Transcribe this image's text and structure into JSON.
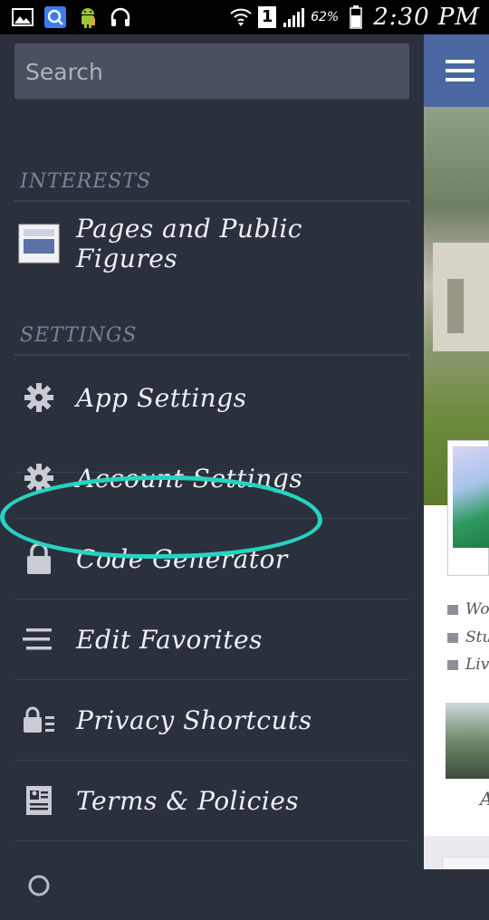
{
  "status_bar": {
    "icons_left": [
      "image-icon",
      "search-app-icon",
      "android-icon",
      "headphones-icon"
    ],
    "sim_slot": "1",
    "battery_percent": "62%",
    "time": "2:30 PM"
  },
  "drawer": {
    "search": {
      "placeholder": "Search"
    },
    "sections": [
      {
        "header": "INTERESTS",
        "items": [
          {
            "label": "Pages and Public Figures",
            "icon": "pages-icon"
          }
        ]
      },
      {
        "header": "SETTINGS",
        "items": [
          {
            "label": "App Settings",
            "icon": "gear-icon"
          },
          {
            "label": "Account Settings",
            "icon": "gear-icon",
            "highlighted": true
          },
          {
            "label": "Code Generator",
            "icon": "lock-icon"
          },
          {
            "label": "Edit Favorites",
            "icon": "list-icon"
          },
          {
            "label": "Privacy Shortcuts",
            "icon": "privacy-lock-icon"
          },
          {
            "label": "Terms & Policies",
            "icon": "document-icon"
          }
        ]
      }
    ],
    "highlight_color": "#26d3c0"
  },
  "content": {
    "topbar_color": "#4b67a1",
    "info_rows": [
      "Wo",
      "Stu",
      "Liv"
    ],
    "thumb_label": "A"
  },
  "colors": {
    "drawer_bg": "#2b303d",
    "search_bg": "#4b505e",
    "section_header": "#7d8291",
    "item_text": "#eef0f4"
  }
}
